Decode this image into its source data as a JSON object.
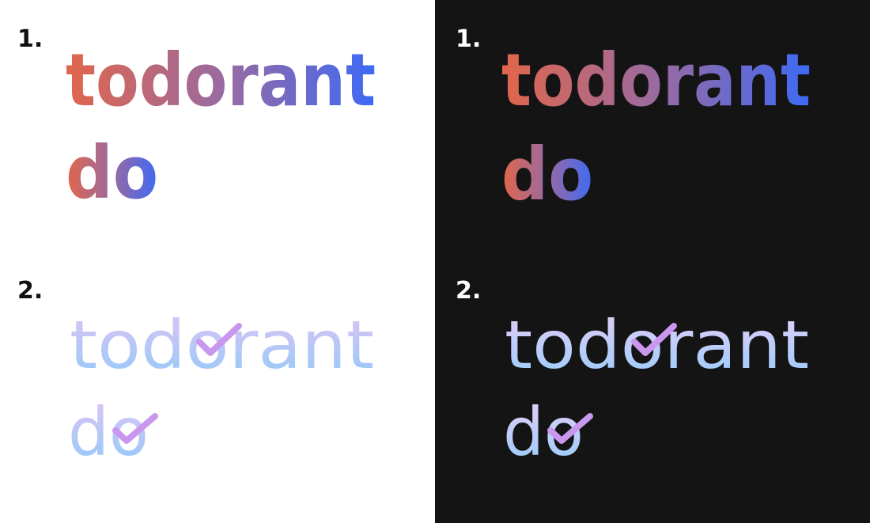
{
  "panels": {
    "light": {
      "background": "#ffffff",
      "label_color": "#111111"
    },
    "dark": {
      "background": "#141414",
      "label_color": "#ffffff"
    }
  },
  "variants": [
    {
      "number": "1.",
      "word_1": "todorant",
      "word_2": "do",
      "style": "bold gradient wordmark",
      "gradient": [
        "#e2664a",
        "#9a6aa0",
        "#3d6af5"
      ]
    },
    {
      "number": "2.",
      "word_1": "todorant",
      "word_2": "do",
      "style": "rounded monoline wordmark with checkmark on the second o",
      "gradient": [
        "#d7c3f4",
        "#9fc9f8"
      ],
      "check_color": "#c998ee"
    }
  ]
}
